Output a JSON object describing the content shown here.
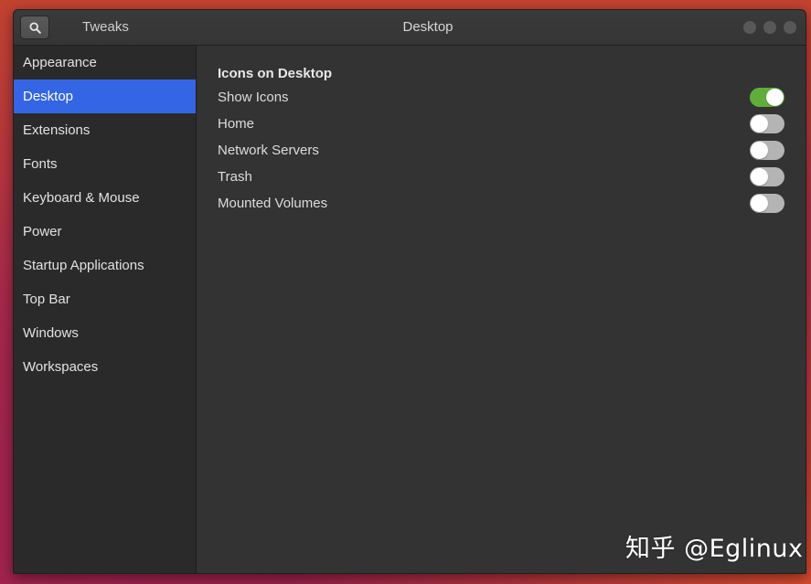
{
  "header": {
    "search_icon": "search-icon",
    "app_title": "Tweaks",
    "page_title": "Desktop",
    "window_controls": [
      "minimize",
      "maximize",
      "close"
    ]
  },
  "sidebar": {
    "items": [
      {
        "label": "Appearance",
        "selected": false
      },
      {
        "label": "Desktop",
        "selected": true
      },
      {
        "label": "Extensions",
        "selected": false
      },
      {
        "label": "Fonts",
        "selected": false
      },
      {
        "label": "Keyboard & Mouse",
        "selected": false
      },
      {
        "label": "Power",
        "selected": false
      },
      {
        "label": "Startup Applications",
        "selected": false
      },
      {
        "label": "Top Bar",
        "selected": false
      },
      {
        "label": "Windows",
        "selected": false
      },
      {
        "label": "Workspaces",
        "selected": false
      }
    ]
  },
  "content": {
    "section_title": "Icons on Desktop",
    "settings": [
      {
        "label": "Show Icons",
        "enabled": true
      },
      {
        "label": "Home",
        "enabled": false
      },
      {
        "label": "Network Servers",
        "enabled": false
      },
      {
        "label": "Trash",
        "enabled": false
      },
      {
        "label": "Mounted Volumes",
        "enabled": false
      }
    ]
  },
  "colors": {
    "selection": "#3465e4",
    "toggle_on": "#5fae3a",
    "toggle_off": "#b4b4b4"
  },
  "watermark": "知乎 @Eglinux"
}
